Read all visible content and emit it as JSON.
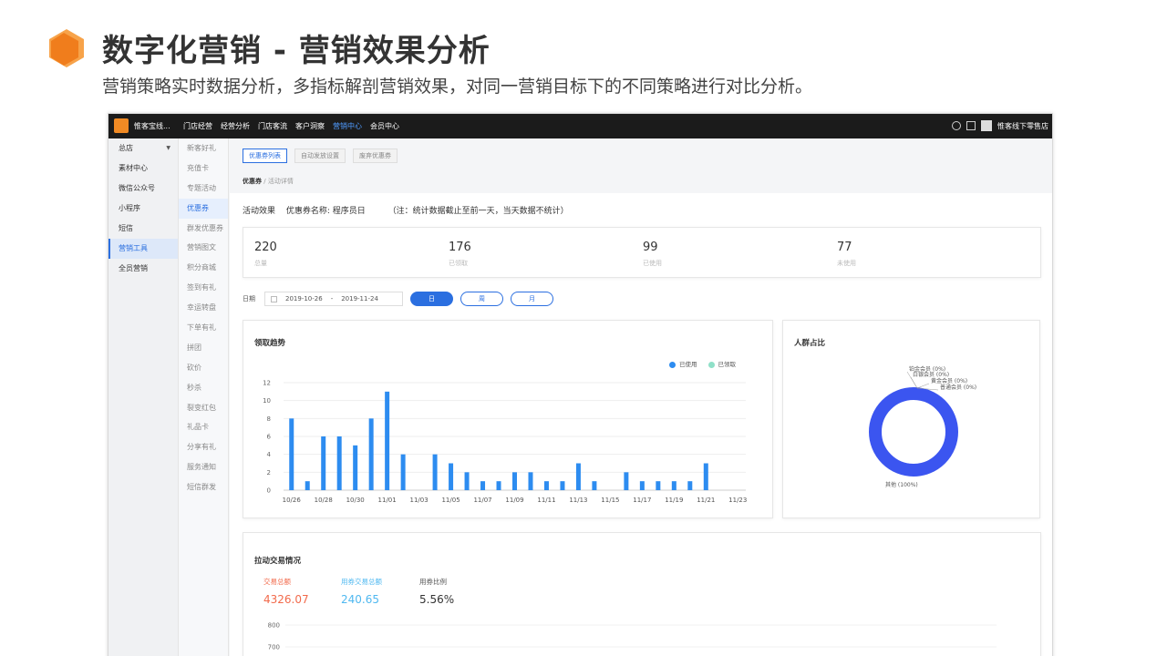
{
  "slide": {
    "title": "数字化营销 - 营销效果分析",
    "subtitle": "营销策略实时数据分析，多指标解剖营销效果，对同一营销目标下的不同策略进行对比分析。"
  },
  "app": {
    "brand_name": "惟客宝线...",
    "nav": [
      "门店经营",
      "经营分析",
      "门店客流",
      "客户洞察",
      "营销中心",
      "会员中心"
    ],
    "nav_active": "营销中心",
    "user_name": "惟客线下零售店",
    "icons": [
      "settings-icon",
      "message-icon",
      "user-avatar-icon"
    ],
    "accent_color": "#2b6fe0",
    "brand_color": "#f08a24"
  },
  "sidebar1": {
    "items": [
      "总店",
      "素材中心",
      "微信公众号",
      "小程序",
      "短信",
      "营销工具",
      "全员营销"
    ],
    "active": "营销工具"
  },
  "sidebar2": {
    "items": [
      "新客好礼",
      "充值卡",
      "专题活动",
      "优惠券",
      "群发优惠券",
      "营销图文",
      "积分商城",
      "签到有礼",
      "幸运转盘",
      "下单有礼",
      "拼团",
      "砍价",
      "秒杀",
      "裂变红包",
      "礼品卡",
      "分享有礼",
      "服务通知",
      "短信群发"
    ],
    "active": "优惠券"
  },
  "main": {
    "tabs": [
      "优惠券列表",
      "自动发放设置",
      "废弃优惠券"
    ],
    "tab_active": "优惠券列表",
    "breadcrumb_current": "优惠券",
    "breadcrumb_sep": "/",
    "breadcrumb_detail": "活动详情",
    "effect_label": "活动效果",
    "coupon_name_label": "优惠券名称: 程序员日",
    "note": "（注：统计数据截止至前一天，当天数据不统计）",
    "stats": [
      {
        "value": "220",
        "label": "总量"
      },
      {
        "value": "176",
        "label": "已领取"
      },
      {
        "value": "99",
        "label": "已使用"
      },
      {
        "value": "77",
        "label": "未使用"
      }
    ],
    "date_label": "日期",
    "date_start": "2019-10-26",
    "date_sep": "-",
    "date_end": "2019-11-24",
    "periods": [
      "日",
      "周",
      "月"
    ],
    "period_active": "日"
  },
  "trend": {
    "title": "领取趋势",
    "legend": [
      {
        "name": "已使用",
        "color": "#2d8cf0"
      },
      {
        "name": "已领取",
        "color": "#8fe0c8"
      }
    ]
  },
  "crowd": {
    "title": "人群占比"
  },
  "trade": {
    "title": "拉动交易情况",
    "kpis": [
      {
        "label": "交易总额",
        "value": "4326.07",
        "color": "#f26a4b"
      },
      {
        "label": "用券交易总额",
        "value": "240.65",
        "color": "#4fb8f0"
      },
      {
        "label": "用券比例",
        "value": "5.56%",
        "color": "#333333"
      }
    ],
    "y_ticks": [
      "800",
      "700"
    ]
  },
  "chart_data": [
    {
      "type": "bar",
      "title": "领取趋势",
      "categories": [
        "10/26",
        "10/27",
        "10/28",
        "10/29",
        "10/30",
        "10/31",
        "11/01",
        "11/02",
        "11/03",
        "11/04",
        "11/05",
        "11/06",
        "11/07",
        "11/08",
        "11/09",
        "11/10",
        "11/11",
        "11/12",
        "11/13",
        "11/14",
        "11/15",
        "11/16",
        "11/17",
        "11/18",
        "11/19",
        "11/20",
        "11/21",
        "11/22",
        "11/23"
      ],
      "x_tick_labels": [
        "10/26",
        "10/28",
        "10/30",
        "11/01",
        "11/03",
        "11/05",
        "11/07",
        "11/09",
        "11/11",
        "11/13",
        "11/15",
        "11/17",
        "11/19",
        "11/21",
        "11/23"
      ],
      "series": [
        {
          "name": "已使用",
          "values": [
            8,
            1,
            6,
            6,
            5,
            8,
            11,
            4,
            0,
            4,
            3,
            2,
            1,
            1,
            2,
            2,
            1,
            1,
            3,
            1,
            0,
            2,
            1,
            1,
            1,
            1,
            3,
            0,
            0
          ]
        }
      ],
      "ylim": [
        0,
        12
      ],
      "y_ticks": [
        0,
        2,
        4,
        6,
        8,
        10,
        12
      ],
      "grid": true,
      "legend": "top-right"
    },
    {
      "type": "pie",
      "title": "人群占比",
      "series": [
        {
          "name": "其他 (100%)",
          "value": 100
        },
        {
          "name": "铂金会员 (0%)",
          "value": 0
        },
        {
          "name": "白银会员 (0%)",
          "value": 0
        },
        {
          "name": "黄金会员 (0%)",
          "value": 0
        },
        {
          "name": "普通会员 (0%)",
          "value": 0
        }
      ],
      "color": "#3b55f0"
    }
  ]
}
